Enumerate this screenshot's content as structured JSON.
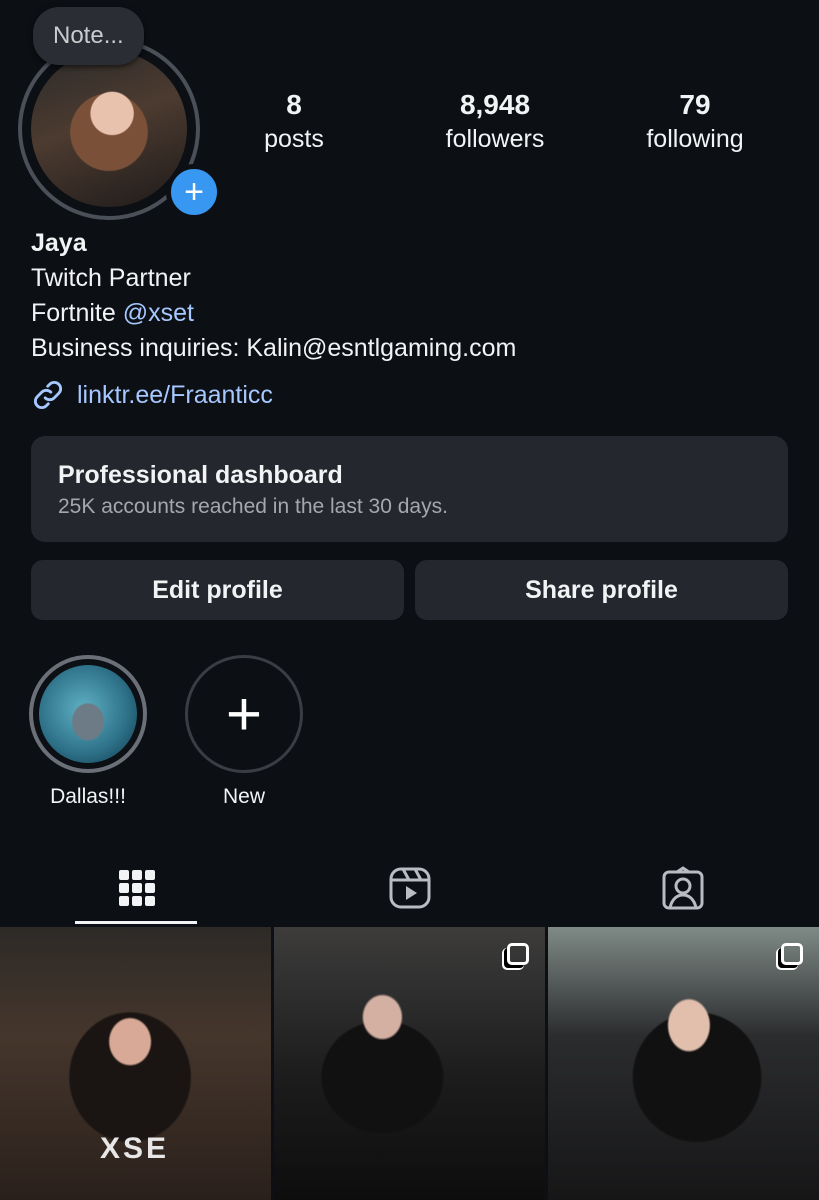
{
  "note": {
    "placeholder": "Note..."
  },
  "stats": [
    {
      "value": "8",
      "label": "posts"
    },
    {
      "value": "8,948",
      "label": "followers"
    },
    {
      "value": "79",
      "label": "following"
    }
  ],
  "profile": {
    "name": "Jaya",
    "bio_line1": "Twitch Partner",
    "bio_line2_prefix": "Fortnite ",
    "bio_line2_mention": "@xset",
    "bio_line3": "Business inquiries: Kalin@esntlgaming.com",
    "link": "linktr.ee/Fraanticc"
  },
  "dashboard": {
    "title": "Professional dashboard",
    "subtitle": "25K accounts reached in the last 30 days."
  },
  "buttons": {
    "edit": "Edit profile",
    "share": "Share profile"
  },
  "highlights": [
    {
      "label": "Dallas!!!"
    },
    {
      "label": "New"
    }
  ],
  "tabs": [
    {
      "icon": "grid-icon",
      "active": true
    },
    {
      "icon": "reels-icon",
      "active": false
    },
    {
      "icon": "tagged-icon",
      "active": false
    }
  ],
  "posts": [
    {
      "overlay_text": "XSE",
      "multi": false
    },
    {
      "multi": true
    },
    {
      "multi": true
    }
  ],
  "colors": {
    "background": "#0c0f14",
    "card": "#24272d",
    "link": "#a6c8ff",
    "badge": "#3897f0"
  }
}
